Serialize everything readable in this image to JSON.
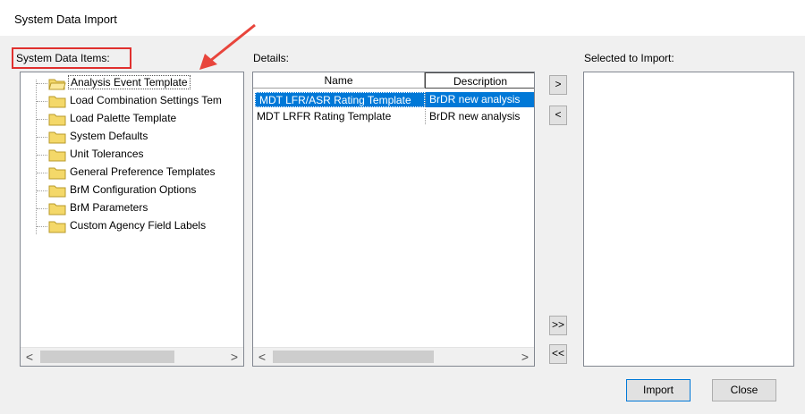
{
  "window": {
    "title": "System Data Import"
  },
  "labels": {
    "system_items": "System Data Items:",
    "details": "Details:",
    "selected": "Selected to Import:"
  },
  "tree_items": [
    {
      "label": "Analysis Event Template",
      "selected": true
    },
    {
      "label": "Load Combination Settings Tem"
    },
    {
      "label": "Load Palette Template"
    },
    {
      "label": "System Defaults"
    },
    {
      "label": "Unit Tolerances"
    },
    {
      "label": "General Preference Templates"
    },
    {
      "label": "BrM Configuration Options"
    },
    {
      "label": "BrM Parameters"
    },
    {
      "label": "Custom Agency Field Labels"
    }
  ],
  "details_grid": {
    "columns": [
      "Name",
      "Description"
    ],
    "rows": [
      {
        "name": "MDT LFR/ASR Rating Template",
        "description": "BrDR new analysis",
        "selected": true
      },
      {
        "name": "MDT LRFR Rating Template",
        "description": "BrDR new analysis"
      }
    ]
  },
  "buttons": {
    "add": ">",
    "remove": "<",
    "add_all": ">>",
    "remove_all": "<<",
    "import": "Import",
    "close": "Close"
  },
  "scroll": {
    "left_arrow": "<",
    "right_arrow": ">"
  },
  "colors": {
    "selection": "#0078d7",
    "highlight_box": "#e0302e",
    "annotation_arrow": "#e8453c"
  }
}
